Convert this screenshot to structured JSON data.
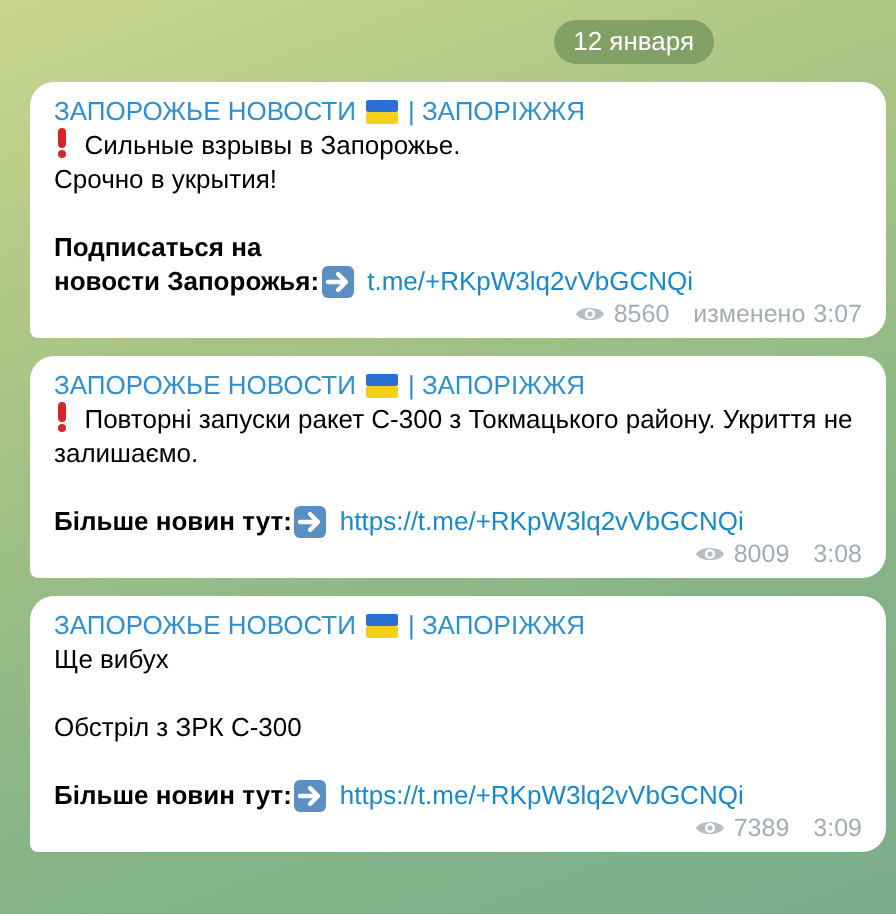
{
  "date_badge": "12 января",
  "messages": [
    {
      "sender": "ЗАПОРОЖЬЕ НОВОСТИ",
      "sender_suffix": "| ЗАПОРІЖЖЯ",
      "paragraphs": [
        [
          {
            "kind": "alert",
            "text": "Сильные взрывы в Запорожье."
          },
          {
            "kind": "text",
            "text": "Срочно в укрытия!"
          }
        ],
        [
          {
            "kind": "bold",
            "text": "Подписаться на"
          },
          {
            "kind": "link",
            "label": "новости Запорожья:",
            "url": "t.me/+RKpW3lq2vVbGCNQi"
          }
        ]
      ],
      "views": "8560",
      "edited": "изменено",
      "time": "3:07"
    },
    {
      "sender": "ЗАПОРОЖЬЕ НОВОСТИ",
      "sender_suffix": "| ЗАПОРІЖЖЯ",
      "paragraphs": [
        [
          {
            "kind": "alert",
            "text": "Повторні запуски ракет С-300 з Токмацького району. Укриття не залишаємо."
          }
        ],
        [
          {
            "kind": "link",
            "label": "Більше новин тут:",
            "url": "https://t.me/+RKpW3lq2vVbGCNQi"
          }
        ]
      ],
      "views": "8009",
      "time": "3:08"
    },
    {
      "sender": "ЗАПОРОЖЬЕ НОВОСТИ",
      "sender_suffix": "| ЗАПОРІЖЖЯ",
      "paragraphs": [
        [
          {
            "kind": "text",
            "text": "Ще вибух"
          }
        ],
        [
          {
            "kind": "text",
            "text": "Обстріл з ЗРК С-300"
          }
        ],
        [
          {
            "kind": "link",
            "label": "Більше новин тут:",
            "url": "https://t.me/+RKpW3lq2vVbGCNQi"
          }
        ]
      ],
      "views": "7389",
      "time": "3:09"
    }
  ]
}
